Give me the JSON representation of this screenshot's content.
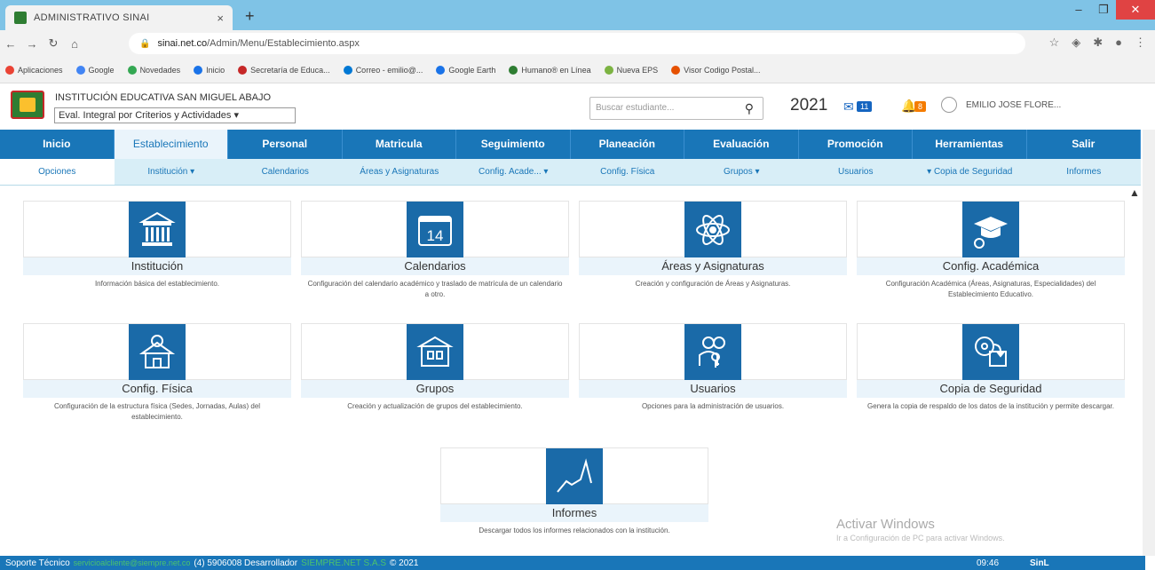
{
  "browser": {
    "tab_title": "ADMINISTRATIVO SINAI",
    "tab_close": "×",
    "new_tab": "+",
    "url_host": "sinai.net.co",
    "url_path": "/Admin/Menu/Establecimiento.aspx",
    "bookmarks": [
      "Aplicaciones",
      "Google",
      "Novedades",
      "Inicio",
      "Secretaría de Educa...",
      "Correo - emilio@...",
      "Google Earth",
      "Humano® en Línea",
      "Nueva EPS",
      "Visor Codigo Postal..."
    ]
  },
  "header": {
    "institution": "INSTITUCIÓN EDUCATIVA SAN MIGUEL ABAJO",
    "eval_select": "Eval. Integral por Criterios y Actividades",
    "search_placeholder": "Buscar estudiante...",
    "year": "2021",
    "mail_count": "11",
    "notif_count": "8",
    "user": "EMILIO JOSE FLORE..."
  },
  "main_nav": [
    "Inicio",
    "Establecimiento",
    "Personal",
    "Matricula",
    "Seguimiento",
    "Planeación",
    "Evaluación",
    "Promoción",
    "Herramientas",
    "Salir"
  ],
  "sub_nav": [
    "Opciones",
    "Institución ▾",
    "Calendarios",
    "Áreas y Asignaturas",
    "Config. Acade... ▾",
    "Config. Física",
    "Grupos ▾",
    "Usuarios",
    "▾ Copia de Seguridad",
    "Informes"
  ],
  "cards": [
    {
      "title": "Institución",
      "desc": "Información básica del establecimiento.",
      "icon": "building-icon"
    },
    {
      "title": "Calendarios",
      "desc": "Configuración del calendario académico y traslado de matrícula de un calendario a otro.",
      "icon": "calendar-icon",
      "day": "14"
    },
    {
      "title": "Áreas y Asignaturas",
      "desc": "Creación y configuración de Áreas y Asignaturas.",
      "icon": "atom-icon"
    },
    {
      "title": "Config. Académica",
      "desc": "Configuración Académica (Áreas, Asignaturas, Especialidades) del Establecimiento Educativo.",
      "icon": "graduation-gear-icon"
    },
    {
      "title": "Config. Física",
      "desc": "Configuración de la estructura física (Sedes, Jornadas, Aulas) del establecimiento.",
      "icon": "house-sun-icon"
    },
    {
      "title": "Grupos",
      "desc": "Creación y actualización de grupos del establecimiento.",
      "icon": "school-group-icon"
    },
    {
      "title": "Usuarios",
      "desc": "Opciones para la administración de usuarios.",
      "icon": "users-key-icon"
    },
    {
      "title": "Copia de Seguridad",
      "desc": "Genera la copia de respaldo de los datos de la institución y permite descargar.",
      "icon": "backup-disk-icon"
    },
    {
      "title": "Informes",
      "desc": "Descargar todos los informes relacionados con la institución.",
      "icon": "line-chart-icon"
    }
  ],
  "watermark": {
    "line1": "Activar Windows",
    "line2": "Ir a Configuración de PC para activar Windows."
  },
  "footer": {
    "support_label": "Soporte Técnico",
    "support_email": "servicioalcliente@siempre.net.co",
    "phone": "(4) 5906008 Desarrollador",
    "brand": "SIEMPRE.NET S.A.S",
    "copyright": "© 2021",
    "clock": "09:46",
    "logo": "SinL"
  }
}
